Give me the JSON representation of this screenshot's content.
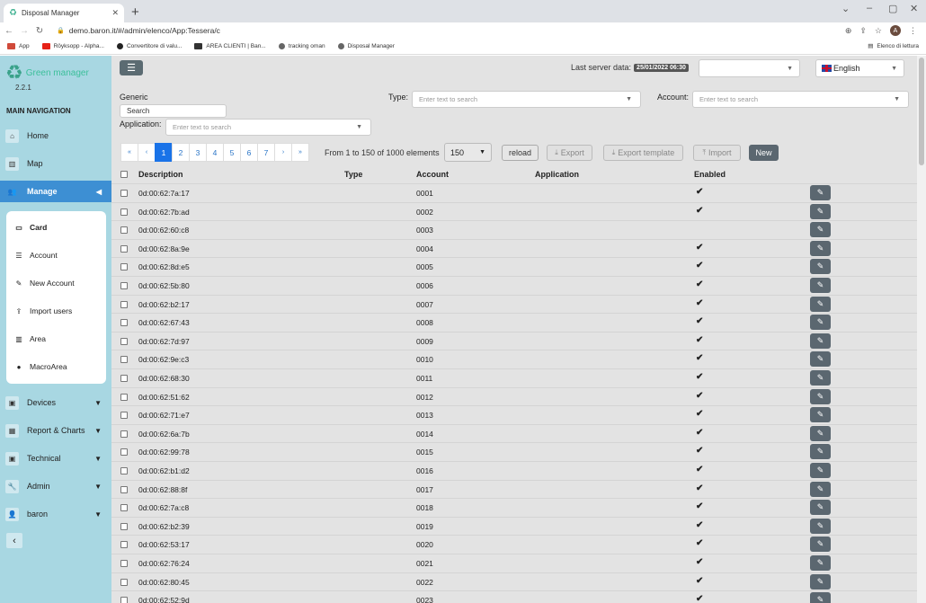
{
  "browser": {
    "tab_title": "Disposal Manager",
    "tab_close": "✕",
    "new_tab": "+",
    "url": "demo.baron.it/#/admin/elenco/App:Tessera/c",
    "avatar_letter": "A",
    "bookmarks": [
      "App",
      "Röyksopp - Alpha...",
      "Convertitore di valu...",
      "AREA CLIENTI | Ban...",
      "tracking oman",
      "Disposal Manager"
    ],
    "reading_list": "Elenco di lettura"
  },
  "sidebar": {
    "app_name": "Green manager",
    "version": "2.2.1",
    "nav_title": "MAIN NAVIGATION",
    "items": [
      {
        "label": "Home",
        "icon": "home-icon"
      },
      {
        "label": "Map",
        "icon": "map-icon"
      },
      {
        "label": "Manage",
        "icon": "users-icon"
      },
      {
        "label": "Devices",
        "icon": "box-icon"
      },
      {
        "label": "Report & Charts",
        "icon": "chart-icon"
      },
      {
        "label": "Technical",
        "icon": "box-icon"
      },
      {
        "label": "Admin",
        "icon": "wrench-icon"
      },
      {
        "label": "baron",
        "icon": "user-icon"
      }
    ],
    "submenu": [
      {
        "label": "Card",
        "icon": "card-icon"
      },
      {
        "label": "Account",
        "icon": "list-icon"
      },
      {
        "label": "New Account",
        "icon": "pencil-icon"
      },
      {
        "label": "Import users",
        "icon": "upload-icon"
      },
      {
        "label": "Area",
        "icon": "map-icon"
      },
      {
        "label": "MacroArea",
        "icon": "globe-icon"
      }
    ]
  },
  "topbar": {
    "last_server_label": "Last server data:",
    "last_server_value": "25/01/2022 06:30",
    "language": "English"
  },
  "filters": {
    "generic_label": "Generic",
    "generic_placeholder": "Search",
    "type_label": "Type:",
    "type_placeholder": "Enter text to search",
    "account_label": "Account:",
    "account_placeholder": "Enter text to search",
    "application_label": "Application:",
    "application_placeholder": "Enter text to search"
  },
  "pagination": {
    "first": "«",
    "prev": "‹",
    "pages": [
      "1",
      "2",
      "3",
      "4",
      "5",
      "6",
      "7"
    ],
    "current_page": "1",
    "next": "›",
    "last": "»",
    "range_text": "From 1 to 150 of 1000 elements",
    "per_page": "150"
  },
  "toolbar": {
    "reload": "reload",
    "export": "Export",
    "export_template": "Export template",
    "import": "Import",
    "new": "New"
  },
  "table": {
    "headers": {
      "description": "Description",
      "type": "Type",
      "account": "Account",
      "application": "Application",
      "enabled": "Enabled"
    },
    "rows": [
      {
        "description": "0d:00:62:7a:17",
        "account": "0001",
        "enabled": true
      },
      {
        "description": "0d:00:62:7b:ad",
        "account": "0002",
        "enabled": true
      },
      {
        "description": "0d:00:62:60:c8",
        "account": "0003",
        "enabled": false
      },
      {
        "description": "0d:00:62:8a:9e",
        "account": "0004",
        "enabled": true
      },
      {
        "description": "0d:00:62:8d:e5",
        "account": "0005",
        "enabled": true
      },
      {
        "description": "0d:00:62:5b:80",
        "account": "0006",
        "enabled": true
      },
      {
        "description": "0d:00:62:b2:17",
        "account": "0007",
        "enabled": true
      },
      {
        "description": "0d:00:62:67:43",
        "account": "0008",
        "enabled": true
      },
      {
        "description": "0d:00:62:7d:97",
        "account": "0009",
        "enabled": true
      },
      {
        "description": "0d:00:62:9e:c3",
        "account": "0010",
        "enabled": true
      },
      {
        "description": "0d:00:62:68:30",
        "account": "0011",
        "enabled": true
      },
      {
        "description": "0d:00:62:51:62",
        "account": "0012",
        "enabled": true
      },
      {
        "description": "0d:00:62:71:e7",
        "account": "0013",
        "enabled": true
      },
      {
        "description": "0d:00:62:6a:7b",
        "account": "0014",
        "enabled": true
      },
      {
        "description": "0d:00:62:99:78",
        "account": "0015",
        "enabled": true
      },
      {
        "description": "0d:00:62:b1:d2",
        "account": "0016",
        "enabled": true
      },
      {
        "description": "0d:00:62:88:8f",
        "account": "0017",
        "enabled": true
      },
      {
        "description": "0d:00:62:7a:c8",
        "account": "0018",
        "enabled": true
      },
      {
        "description": "0d:00:62:b2:39",
        "account": "0019",
        "enabled": true
      },
      {
        "description": "0d:00:62:53:17",
        "account": "0020",
        "enabled": true
      },
      {
        "description": "0d:00:62:76:24",
        "account": "0021",
        "enabled": true
      },
      {
        "description": "0d:00:62:80:45",
        "account": "0022",
        "enabled": true
      },
      {
        "description": "0d:00:62:52:9d",
        "account": "0023",
        "enabled": true
      }
    ]
  },
  "colors": {
    "sidebar_bg": "#a8d7e2",
    "active_nav": "#3d8fd3",
    "brand_green": "#3bbf9a",
    "button_dark": "#5b6770"
  }
}
